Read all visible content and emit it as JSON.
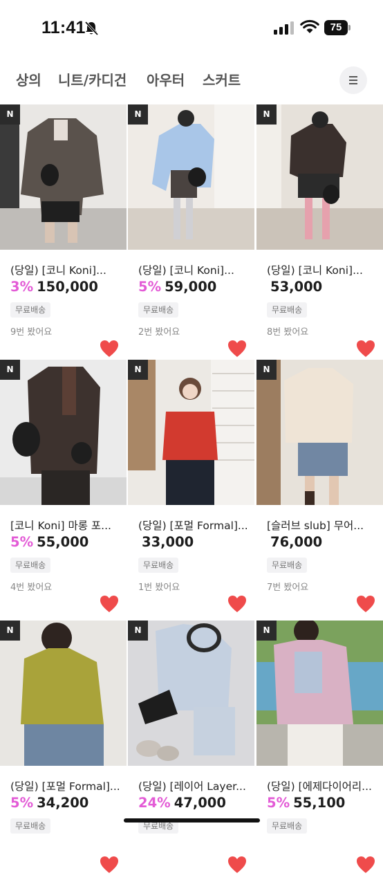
{
  "status_bar": {
    "time": "11:41",
    "battery": "75",
    "icons": [
      "bell-slash-icon",
      "signal-icon",
      "wifi-icon",
      "battery-icon"
    ]
  },
  "tabs": [
    {
      "label": "상의"
    },
    {
      "label": "니트/카디건"
    },
    {
      "label": "아우터"
    },
    {
      "label": "스커트"
    }
  ],
  "menu_icon": "hamburger-menu-icon",
  "colors": {
    "discount": "#e35bd6",
    "heart": "#ef4b4b",
    "badge_bg": "#2b2b2b"
  },
  "products": [
    {
      "badge": "N",
      "name": "(당일) [코니 Koni]...",
      "discount": "3%",
      "price": "150,000",
      "shipping": "무료배송",
      "views": "9번 봤어요",
      "liked": true
    },
    {
      "badge": "N",
      "name": "(당일) [코니 Koni]...",
      "discount": "5%",
      "price": "59,000",
      "shipping": "무료배송",
      "views": "2번 봤어요",
      "liked": true
    },
    {
      "badge": "N",
      "name": "(당일) [코니 Koni]...",
      "discount": "",
      "price": "53,000",
      "shipping": "무료배송",
      "views": "8번 봤어요",
      "liked": true
    },
    {
      "badge": "N",
      "name": "[코니 Koni] 마롱 포...",
      "discount": "5%",
      "price": "55,000",
      "shipping": "무료배송",
      "views": "4번 봤어요",
      "liked": true
    },
    {
      "badge": "N",
      "name": "(당일) [포멀 Formal]...",
      "discount": "",
      "price": "33,000",
      "shipping": "무료배송",
      "views": "1번 봤어요",
      "liked": true
    },
    {
      "badge": "N",
      "name": "[슬러브 slub] 무어...",
      "discount": "",
      "price": "76,000",
      "shipping": "무료배송",
      "views": "7번 봤어요",
      "liked": true
    },
    {
      "badge": "N",
      "name": "(당일) [포멀 Formal]...",
      "discount": "5%",
      "price": "34,200",
      "shipping": "무료배송",
      "views": "",
      "liked": true
    },
    {
      "badge": "N",
      "name": "(당일) [레이어 Layer...",
      "discount": "24%",
      "price": "47,000",
      "shipping": "무료배송",
      "views": "",
      "liked": true
    },
    {
      "badge": "N",
      "name": "(당일) [에제다이어리...",
      "discount": "5%",
      "price": "55,100",
      "shipping": "무료배송",
      "views": "",
      "liked": true
    }
  ]
}
